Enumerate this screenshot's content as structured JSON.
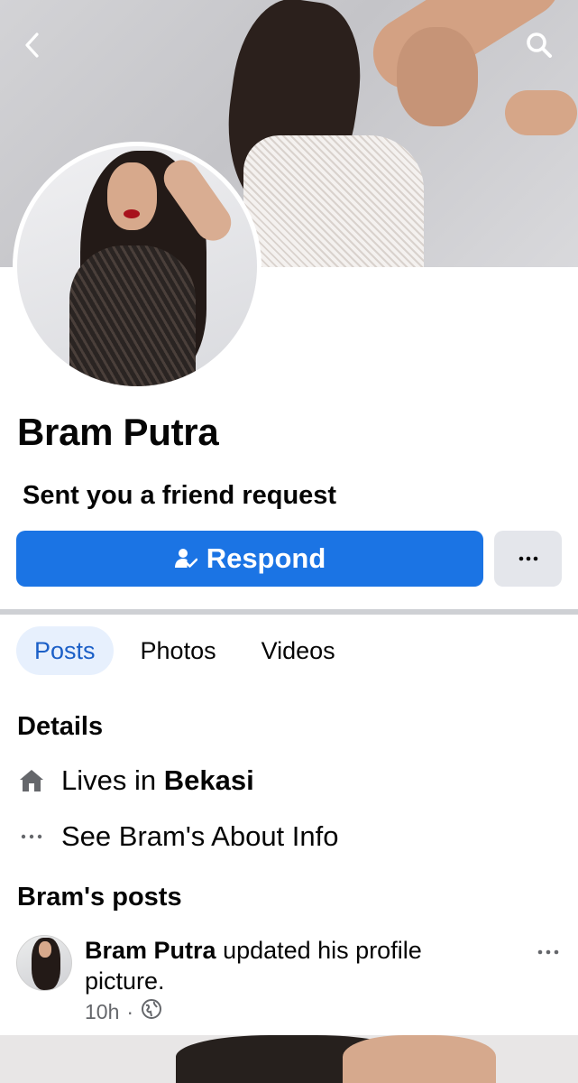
{
  "profile": {
    "name": "Bram Putra",
    "request_text": "Sent you a friend request"
  },
  "actions": {
    "respond_label": "Respond",
    "more_label": "···"
  },
  "tabs": [
    {
      "label": "Posts",
      "active": true
    },
    {
      "label": "Photos",
      "active": false
    },
    {
      "label": "Videos",
      "active": false
    }
  ],
  "details": {
    "title": "Details",
    "lives_prefix": "Lives in",
    "lives_city": "Bekasi",
    "about_link": "See Bram's About Info"
  },
  "posts": {
    "title": "Bram's posts",
    "items": [
      {
        "author": "Bram Putra",
        "action": "updated his profile picture.",
        "time": "10h",
        "separator": "·",
        "privacy_icon": "globe-icon"
      }
    ]
  },
  "icons": {
    "back": "chevron-left-icon",
    "search": "search-icon",
    "respond": "person-check-icon",
    "home": "home-icon",
    "more": "ellipsis-icon"
  },
  "colors": {
    "primary": "#1b74e4",
    "active_tab_bg": "#e7f0fd",
    "active_tab_text": "#1b5fc7",
    "secondary_button": "#e4e6eb",
    "meta_text": "#65676b"
  }
}
